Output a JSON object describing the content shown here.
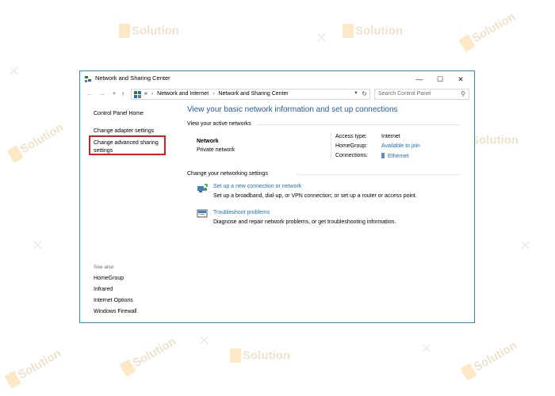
{
  "window": {
    "title": "Network and Sharing Center",
    "controls": {
      "minimize": "—",
      "maximize": "☐",
      "close": "✕"
    }
  },
  "address": {
    "prefix": "«",
    "crumbs": [
      "Network and Internet",
      "Network and Sharing Center"
    ],
    "separator": "›",
    "search_placeholder": "Search Control Panel"
  },
  "leftnav": {
    "home": "Control Panel Home",
    "adapter": "Change adapter settings",
    "advanced": "Change advanced sharing settings",
    "see_also_label": "See also",
    "see_also": [
      "HomeGroup",
      "Infrared",
      "Internet Options",
      "Windows Firewall"
    ]
  },
  "main": {
    "title": "View your basic network information and set up connections",
    "active_section": "View your active networks",
    "network_name": "Network",
    "network_type": "Private network",
    "access_label": "Access type:",
    "access_value": "Internet",
    "homegroup_label": "HomeGroup:",
    "homegroup_value": "Available to join",
    "connections_label": "Connections:",
    "connections_value": "Ethernet",
    "change_section": "Change your networking settings",
    "tasks": [
      {
        "link": "Set up a new connection or network",
        "desc": "Set up a broadband, dial-up, or VPN connection; or set up a router or access point."
      },
      {
        "link": "Troubleshoot problems",
        "desc": "Diagnose and repair network problems, or get troubleshooting information."
      }
    ]
  },
  "watermark": {
    "brand": "Solution",
    "tagline": "iSolution"
  },
  "colors": {
    "accent_border": "#2b88d8",
    "title_blue": "#1e5a9e",
    "link_blue": "#1e6fc2",
    "highlight_red": "#e01a1a"
  }
}
